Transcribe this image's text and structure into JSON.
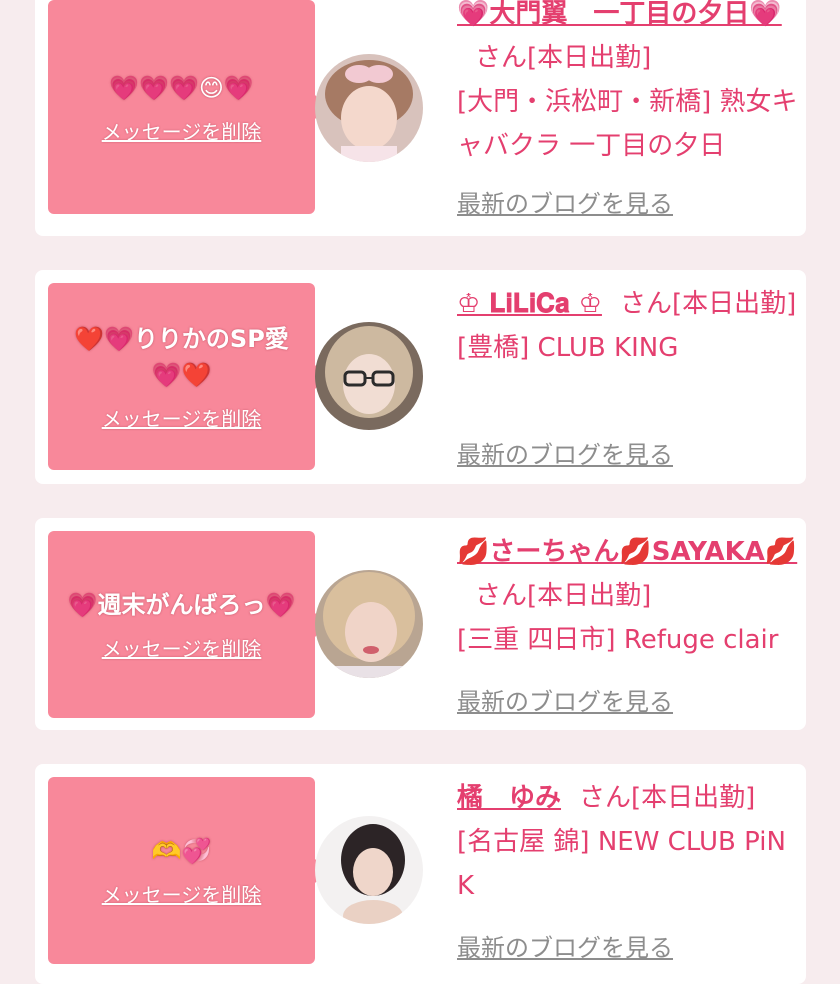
{
  "cards": [
    {
      "message": "💗💗💗😊💗",
      "delete_label": "メッセージを削除",
      "cast_name": "💗大門翼　一丁目の夕日💗",
      "san_suffix": "さん[本日出勤]",
      "shop": "[大門・浜松町・新橋] 熟女キャバクラ 一丁目の夕日",
      "blog_link": "最新のブログを見る",
      "avatar": "avatar-photo"
    },
    {
      "message": "❤️💗りりかのSP愛💗❤️",
      "delete_label": "メッセージを削除",
      "cast_name": "♔ 𝐋𝐢𝐋𝐢𝐂𝐚 ♔",
      "san_suffix": "さん[本日出勤]",
      "shop": "[豊橋] CLUB KING",
      "blog_link": "最新のブログを見る",
      "avatar": "avatar-photo"
    },
    {
      "message": "💗週末がんばろっ💗",
      "delete_label": "メッセージを削除",
      "cast_name": "💋さーちゃん💋SAYAKA💋",
      "san_suffix": "さん[本日出勤]",
      "shop": "[三重 四日市] Refuge clair",
      "blog_link": "最新のブログを見る",
      "avatar": "avatar-photo"
    },
    {
      "message": "🫶💞",
      "delete_label": "メッセージを削除",
      "cast_name": "橘　ゆみ",
      "san_suffix": "さん[本日出勤]",
      "shop": "[名古屋 錦] NEW CLUB PiNK",
      "blog_link": "最新のブログを見る",
      "avatar": "avatar-photo"
    }
  ],
  "colors": {
    "accent": "#e43f6f",
    "bubble": "#f8889a",
    "background": "#f7ecee"
  }
}
